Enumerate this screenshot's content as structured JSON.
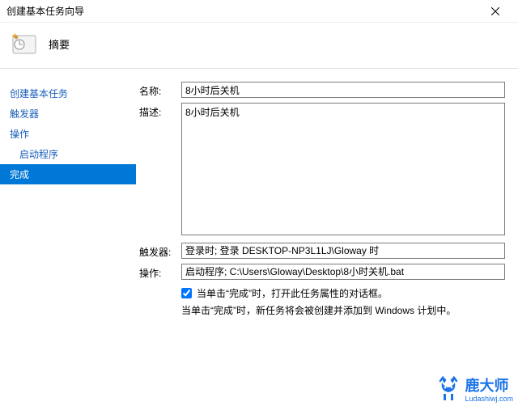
{
  "window": {
    "title": "创建基本任务向导"
  },
  "header": {
    "heading": "摘要"
  },
  "sidebar": {
    "items": [
      {
        "label": "创建基本任务",
        "indent": false,
        "selected": false
      },
      {
        "label": "触发器",
        "indent": false,
        "selected": false
      },
      {
        "label": "操作",
        "indent": false,
        "selected": false
      },
      {
        "label": "启动程序",
        "indent": true,
        "selected": false
      },
      {
        "label": "完成",
        "indent": false,
        "selected": true
      }
    ]
  },
  "form": {
    "name_label": "名称:",
    "name_value": "8小时后关机",
    "desc_label": "描述:",
    "desc_value": "8小时后关机",
    "trigger_label": "触发器:",
    "trigger_value": "登录时; 登录 DESKTOP-NP3L1LJ\\Gloway 时",
    "action_label": "操作:",
    "action_value": "启动程序; C:\\Users\\Gloway\\Desktop\\8小时关机.bat",
    "open_properties_checked": true,
    "open_properties_label": "当单击“完成”时，打开此任务属性的对话框。",
    "note": "当单击“完成”时，新任务将会被创建并添加到 Windows 计划中。"
  },
  "watermark": {
    "brand": "鹿大师",
    "url": "Ludashiwj.com"
  }
}
